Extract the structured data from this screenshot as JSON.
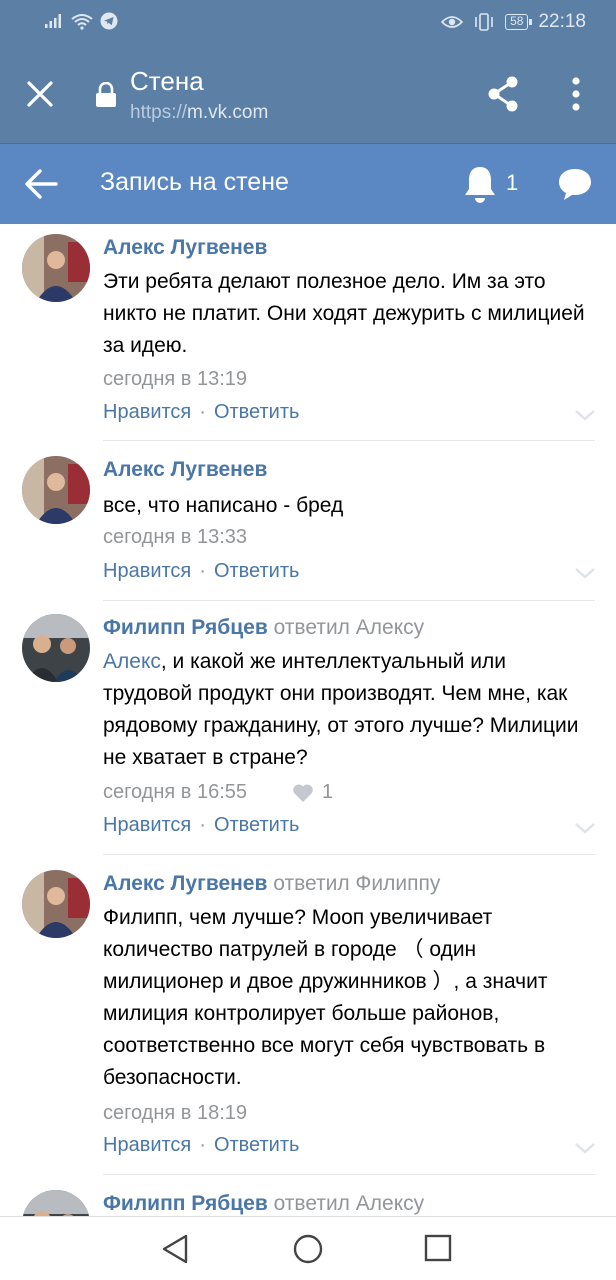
{
  "status_bar": {
    "time": "22:18",
    "battery": "58"
  },
  "browser": {
    "title": "Стена",
    "url_protocol": "https://",
    "url_host": "m.vk.com"
  },
  "header": {
    "title": "Запись на стене",
    "notification_count": "1"
  },
  "comments": [
    {
      "author": "Алекс Лугвенев",
      "reply_to": "",
      "mention": "",
      "text": "Эти ребята делают полезное дело. Им за это никто не платит. Они ходят дежурить с милицией за идею.",
      "time": "сегодня в 13:19",
      "likes": "",
      "like_label": "Нравится",
      "reply_label": "Ответить"
    },
    {
      "author": "Алекс Лугвенев",
      "reply_to": "",
      "mention": "",
      "text": "все, что написано - бред",
      "time": "сегодня в 13:33",
      "likes": "",
      "like_label": "Нравится",
      "reply_label": "Ответить"
    },
    {
      "author": "Филипп Рябцев",
      "reply_to": "ответил Алексу",
      "mention": "Алекс",
      "text": ", и какой же интеллектуальный или трудовой продукт они производят. Чем мне, как рядовому гражданину, от этого лучше? Милиции не хватает в стране?",
      "time": "сегодня в 16:55",
      "likes": "1",
      "like_label": "Нравится",
      "reply_label": "Ответить"
    },
    {
      "author": "Алекс Лугвенев",
      "reply_to": "ответил Филиппу",
      "mention": "",
      "text": "Филипп, чем лучше? Мооп увеличивает количество патрулей в городе （ один милиционер и двое дружинников ）, а значит милиция контролирует больше районов, соответственно все могут себя чувствовать в безопасности.",
      "time": "сегодня в 18:19",
      "likes": "",
      "like_label": "Нравится",
      "reply_label": "Ответить"
    },
    {
      "author": "Филипп Рябцев",
      "reply_to": "ответил Алексу",
      "mention": "",
      "text": "",
      "time": "",
      "likes": "",
      "like_label": "",
      "reply_label": ""
    }
  ],
  "colors": {
    "status_bar": "#5b7fa5",
    "vk_header": "#5b87c2",
    "link": "#4a76a8",
    "meta": "#939699"
  },
  "icons": {
    "status_left": [
      "signal-icon",
      "wifi-icon",
      "telegram-icon"
    ],
    "status_right": [
      "eye-icon",
      "vibrate-icon",
      "battery-icon"
    ],
    "browser": [
      "close-icon",
      "lock-icon",
      "share-icon",
      "more-vert-icon"
    ],
    "header": [
      "back-arrow-icon",
      "bell-icon",
      "messages-icon"
    ],
    "nav": [
      "nav-back-icon",
      "nav-home-icon",
      "nav-recent-icon"
    ]
  }
}
